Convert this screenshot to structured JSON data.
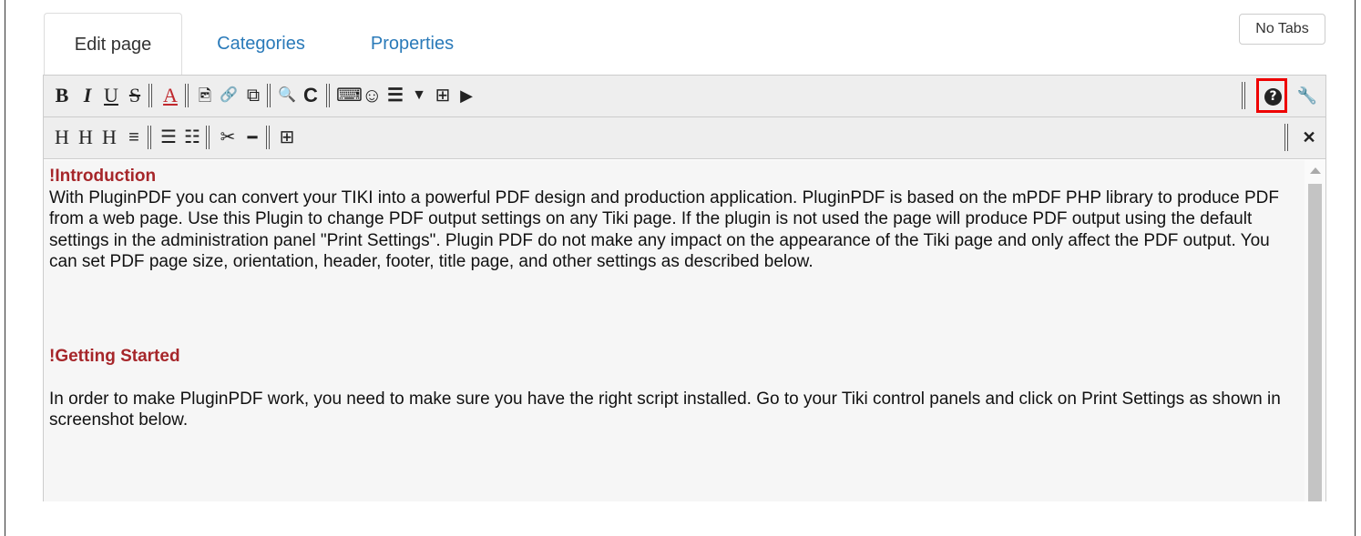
{
  "tabs": {
    "edit": "Edit page",
    "categories": "Categories",
    "properties": "Properties",
    "no_tabs": "No Tabs"
  },
  "toolbar1": {
    "bold": "B",
    "italic": "I",
    "underline": "U",
    "strike": "S",
    "color": "A",
    "image": "🖻",
    "link": "🔗",
    "external": "⧉",
    "search": "🔍",
    "refresh": "C",
    "keyboard": "⌨",
    "smiley": "☺",
    "database": "☰",
    "filter": "▼",
    "table": "⊞",
    "play": "▶",
    "help": "?",
    "wrench": "🔧"
  },
  "toolbar2": {
    "h1": "H",
    "h2": "H",
    "h3": "H",
    "align": "≡",
    "ul": "☰",
    "ol": "☷",
    "cut": "✂",
    "hr": "━",
    "table": "⊞",
    "fullscreen": "✕"
  },
  "content": {
    "heading1": "!Introduction",
    "para1": "With PluginPDF you can convert your TIKI into a powerful PDF design and production application. PluginPDF is based on the mPDF PHP library to produce PDF from a web page. Use this Plugin to change PDF output settings on any Tiki page. If the plugin is not used the page will produce PDF output using the default settings in the administration panel \"Print Settings\". Plugin PDF do not make any impact on the appearance of the Tiki page and only affect the PDF output. You can set PDF page size, orientation, header, footer, title page, and other settings as described below.",
    "heading2": "!Getting Started",
    "para2": "In order to make PluginPDF work, you need to make sure you have the right script installed. Go to your Tiki control panels and click on Print Settings as shown in screenshot below."
  },
  "colors": {
    "heading": "#a6262a",
    "link": "#2a7ab9",
    "highlight": "#e00000"
  }
}
